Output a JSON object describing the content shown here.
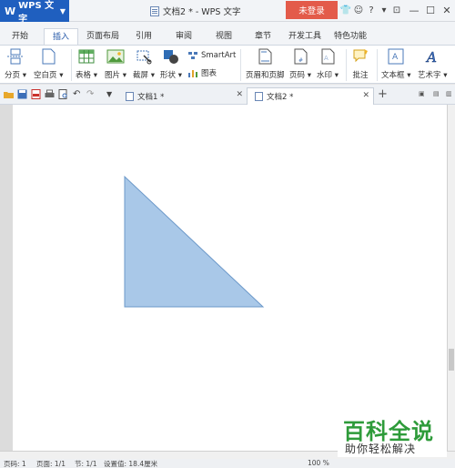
{
  "titlebar": {
    "app_label": "WPS 文字",
    "app_letter": "W",
    "doc_title": "文档2 * - WPS 文字",
    "login_label": "未登录"
  },
  "menu": {
    "tabs": [
      "开始",
      "插入",
      "页面布局",
      "引用",
      "审阅",
      "视图",
      "章节",
      "开发工具",
      "特色功能"
    ],
    "active": "插入"
  },
  "ribbon": {
    "page_break": "分页",
    "blank_page": "空白页",
    "table": "表格",
    "picture": "图片",
    "screenshot": "截屏",
    "shape": "形状",
    "smartart": "SmartArt",
    "chart": "图表",
    "header_footer": "页眉和页脚",
    "page_number": "页码",
    "watermark": "水印",
    "comment": "批注",
    "textbox": "文本框",
    "wordart": "艺术字"
  },
  "doc_tabs": [
    {
      "label": "文档1 *",
      "active": false
    },
    {
      "label": "文档2 *",
      "active": true
    }
  ],
  "status": {
    "section": "页码: 1",
    "page": "页面: 1/1",
    "sections": "节: 1/1",
    "setting": "设置值: 18.4厘米",
    "zoom": "100 %"
  },
  "watermark": {
    "title": "百科全说",
    "subtitle": "助你轻松解决"
  },
  "colors": {
    "app_blue": "#1f5fbf",
    "login_red": "#e35b4a",
    "triangle_fill": "#a9c8e8",
    "triangle_stroke": "#6b98c9",
    "watermark_green": "#2e9b3a"
  }
}
